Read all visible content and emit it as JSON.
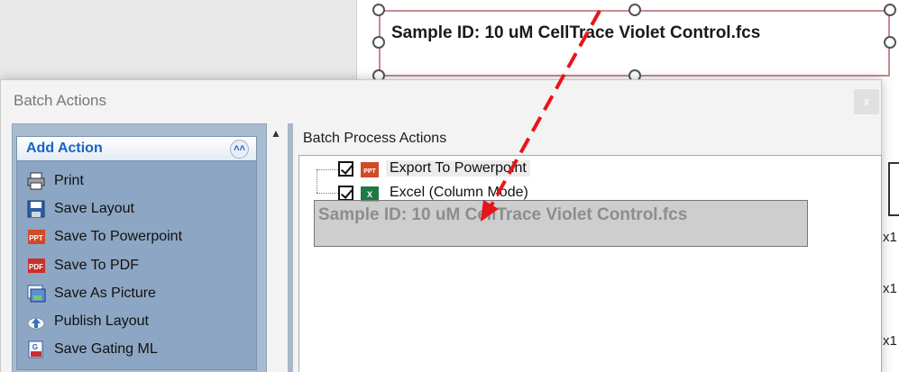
{
  "canvas": {
    "textbox_text": "Sample ID: 10 uM CellTrace Violet Control.fcs",
    "side_labels": [
      "x1",
      "x1",
      "x1"
    ]
  },
  "dialog": {
    "title": "Batch Actions",
    "close_label": "x",
    "add_action": {
      "title": "Add Action",
      "collapse_glyph": "˄˄",
      "items": [
        {
          "label": "Print",
          "icon": "printer-icon"
        },
        {
          "label": "Save Layout",
          "icon": "save-layout-icon"
        },
        {
          "label": "Save To Powerpoint",
          "icon": "powerpoint-icon"
        },
        {
          "label": "Save To PDF",
          "icon": "pdf-icon"
        },
        {
          "label": "Save As Picture",
          "icon": "picture-icon"
        },
        {
          "label": "Publish Layout",
          "icon": "cloud-upload-icon"
        },
        {
          "label": "Save Gating ML",
          "icon": "gating-ml-icon"
        }
      ]
    },
    "scroll_up_glyph": "▲",
    "batch_process": {
      "title": "Batch Process Actions",
      "items": [
        {
          "label": "Export To Powerpoint",
          "checked": true,
          "icon": "powerpoint-icon"
        },
        {
          "label": "Excel (Column Mode)",
          "checked": true,
          "icon": "excel-icon"
        }
      ]
    },
    "drag_ghost_text": "Sample ID: 10 uM CellTrace Violet Control.fcs"
  },
  "colors": {
    "accent_blue": "#1565c7",
    "panel_blue": "#8da6c3",
    "arrow_red": "#e8141b"
  }
}
